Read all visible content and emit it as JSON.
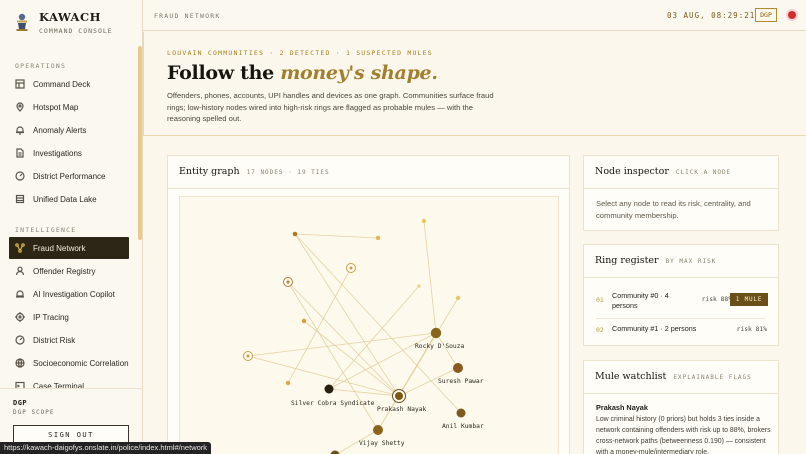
{
  "brand": {
    "name": "KAWACH",
    "subtitle": "COMMAND CONSOLE"
  },
  "sidebar": {
    "operations_label": "OPERATIONS",
    "operations": [
      {
        "label": "Command Deck",
        "icon": "grid-icon"
      },
      {
        "label": "Hotspot Map",
        "icon": "pin-icon"
      },
      {
        "label": "Anomaly Alerts",
        "icon": "bell-icon"
      },
      {
        "label": "Investigations",
        "icon": "file-icon"
      },
      {
        "label": "District Performance",
        "icon": "gauge-icon"
      },
      {
        "label": "Unified Data Lake",
        "icon": "database-icon"
      }
    ],
    "intelligence_label": "INTELLIGENCE",
    "intelligence": [
      {
        "label": "Fraud Network",
        "icon": "network-icon",
        "active": true
      },
      {
        "label": "Offender Registry",
        "icon": "user-icon"
      },
      {
        "label": "AI Investigation Copilot",
        "icon": "bot-icon"
      },
      {
        "label": "IP Tracing",
        "icon": "target-icon"
      },
      {
        "label": "District Risk",
        "icon": "gauge-icon"
      },
      {
        "label": "Socioeconomic Correlation",
        "icon": "layers-icon"
      },
      {
        "label": "Case Terminal",
        "icon": "terminal-icon"
      }
    ],
    "user_role": "DGP",
    "user_scope": "DGP SCOPE",
    "signout_label": "SIGN OUT"
  },
  "status_url": "https://kawach-daigofys.onslate.in/police/index.html#/network",
  "topbar": {
    "breadcrumb": "FRAUD NETWORK",
    "datetime": "03 AUG, 08:29:21",
    "role_badge": "DGP"
  },
  "hero": {
    "eyebrow": "LOUVAIN COMMUNITIES · 2 DETECTED · 1 SUSPECTED MULES",
    "title_plain": "Follow the ",
    "title_italic": "money's shape.",
    "description": "Offenders, phones, accounts, UPI handles and devices as one graph. Communities surface fraud rings; low-history nodes wired into high-risk rings are flagged as probable mules — with the reasoning spelled out."
  },
  "graph": {
    "title": "Entity graph",
    "meta": "17 NODES · 19 TIES",
    "node_labels": [
      "Rocky D'Souza",
      "Suresh Pawar",
      "Silver Cobra Syndicate",
      "Prakash Nayak",
      "Anil Kumbar",
      "Vijay Shetty"
    ]
  },
  "inspector": {
    "title": "Node inspector",
    "meta": "CLICK A NODE",
    "body": "Select any node to read its risk, centrality, and community membership."
  },
  "ring_register": {
    "title": "Ring register",
    "meta": "BY MAX RISK",
    "rings": [
      {
        "index": "01",
        "name": "Community #0 · 4 persons",
        "risk": "risk 88%",
        "badge": "1 MULE"
      },
      {
        "index": "02",
        "name": "Community #1 · 2 persons",
        "risk": "risk 81%",
        "badge": ""
      }
    ]
  },
  "mule_watchlist": {
    "title": "Mule watchlist",
    "meta": "EXPLAINABLE FLAGS",
    "entries": [
      {
        "name": "Prakash Nayak",
        "reason": "Low criminal history (0 priors) but holds 3 ties inside a network containing offenders with risk up to 88%, brokers cross-network paths (betweenness 0.190) — consistent with a money-mule/intermediary role."
      }
    ]
  },
  "colors": {
    "accent_gold": "#c09b3a",
    "active_nav_bg": "#2c2616",
    "mule_badge": "#6a4f17",
    "alert_red": "#d42b2b"
  }
}
